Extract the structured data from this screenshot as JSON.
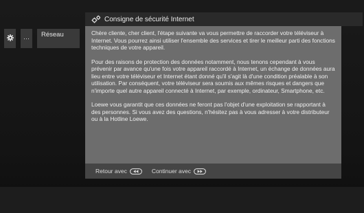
{
  "menu": {
    "more_label": "···",
    "active_label": "Réseau",
    "icons": [
      "gear-icon"
    ]
  },
  "dialog": {
    "title": "Consigne de sécurité Internet",
    "title_icon": "gears-icon",
    "paragraphs": [
      "Chère cliente, cher client, l'étape suivante va vous permettre de raccorder votre téléviseur à Internet. Vous pourrez ainsi utiliser l'ensemble des services et tirer le meilleur parti des fonctions techniques de votre appareil.",
      "Pour des raisons de protection des données notamment, nous tenons cependant à vous prévenir par avance qu'une fois votre appareil raccordé à Internet, un échange de données aura lieu entre votre téléviseur et Internet étant donné qu'il s'agit là d'une condition préalable à son utilisation. Par conséquent, votre téléviseur sera soumis aux mêmes risques et dangers que n'importe quel autre appareil connecté à Internet, par exemple, ordinateur, Smartphone, etc.",
      "Loewe vous garantit que ces données ne feront pas l'objet d'une exploitation se rapportant à des personnes. Si vous avez des questions, n'hésitez pas à vous adresser à votre distributeur ou à la Hotline Loewe."
    ],
    "footer": {
      "back_label": "Retour avec",
      "back_icon": "rewind-key-icon",
      "continue_label": "Continuer avec",
      "continue_icon": "fast-forward-key-icon"
    }
  },
  "colors": {
    "background": "#141414",
    "dialog_body": "#6d6d6d",
    "dialog_title_bar": "#2a2a2a",
    "dialog_footer": "#454545",
    "menu_item": "#3a3a3a",
    "text": "#f1f1f1"
  }
}
